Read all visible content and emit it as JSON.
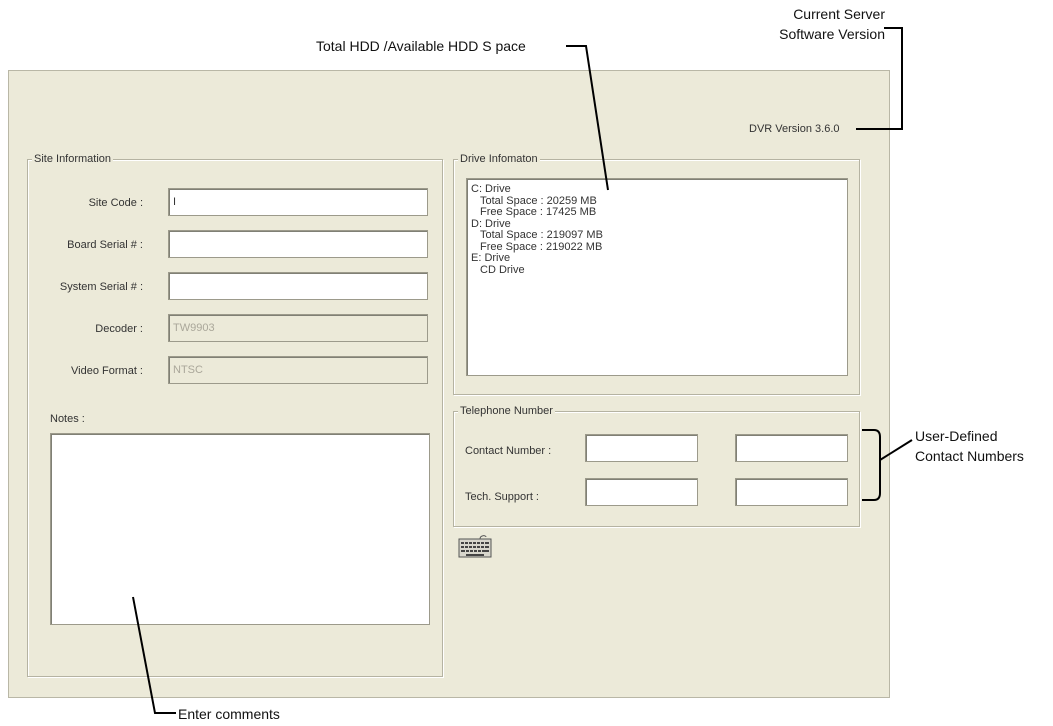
{
  "callouts": {
    "server_version_line1": "Current Server",
    "server_version_line2": "Software Version",
    "hdd_space": "Total HDD /Available HDD S pace",
    "contact_numbers_line1": "User-Defined",
    "contact_numbers_line2": "Contact Numbers",
    "enter_comments": "Enter comments"
  },
  "dvr_version": "DVR Version 3.6.0",
  "site_information": {
    "title": "Site Information",
    "fields": [
      {
        "label": "Site Code :",
        "value": "I",
        "enabled": true
      },
      {
        "label": "Board Serial # :",
        "value": "",
        "enabled": true
      },
      {
        "label": "System Serial # :",
        "value": "",
        "enabled": true
      },
      {
        "label": "Decoder :",
        "value": "TW9903",
        "enabled": false
      },
      {
        "label": "Video Format :",
        "value": "NTSC",
        "enabled": false
      }
    ],
    "notes_label": "Notes :",
    "notes_value": ""
  },
  "drive_information": {
    "title": "Drive Infomaton",
    "lines": [
      {
        "text": "C: Drive",
        "indent": false
      },
      {
        "text": "Total Space : 20259 MB",
        "indent": true
      },
      {
        "text": "Free Space : 17425 MB",
        "indent": true
      },
      {
        "text": "D: Drive",
        "indent": false
      },
      {
        "text": "Total Space : 219097 MB",
        "indent": true
      },
      {
        "text": "Free Space : 219022 MB",
        "indent": true
      },
      {
        "text": "E: Drive",
        "indent": false
      },
      {
        "text": "CD Drive",
        "indent": true
      }
    ]
  },
  "telephone_number": {
    "title": "Telephone Number",
    "rows": [
      {
        "label": "Contact Number :",
        "value1": "",
        "value2": ""
      },
      {
        "label": "Tech. Support :",
        "value1": "",
        "value2": ""
      }
    ]
  },
  "icons": {
    "keyboard_button": "keyboard-icon"
  },
  "colors": {
    "panel_bg": "#ecead9",
    "field_bg": "#ffffff",
    "callout_line": "#000000"
  }
}
